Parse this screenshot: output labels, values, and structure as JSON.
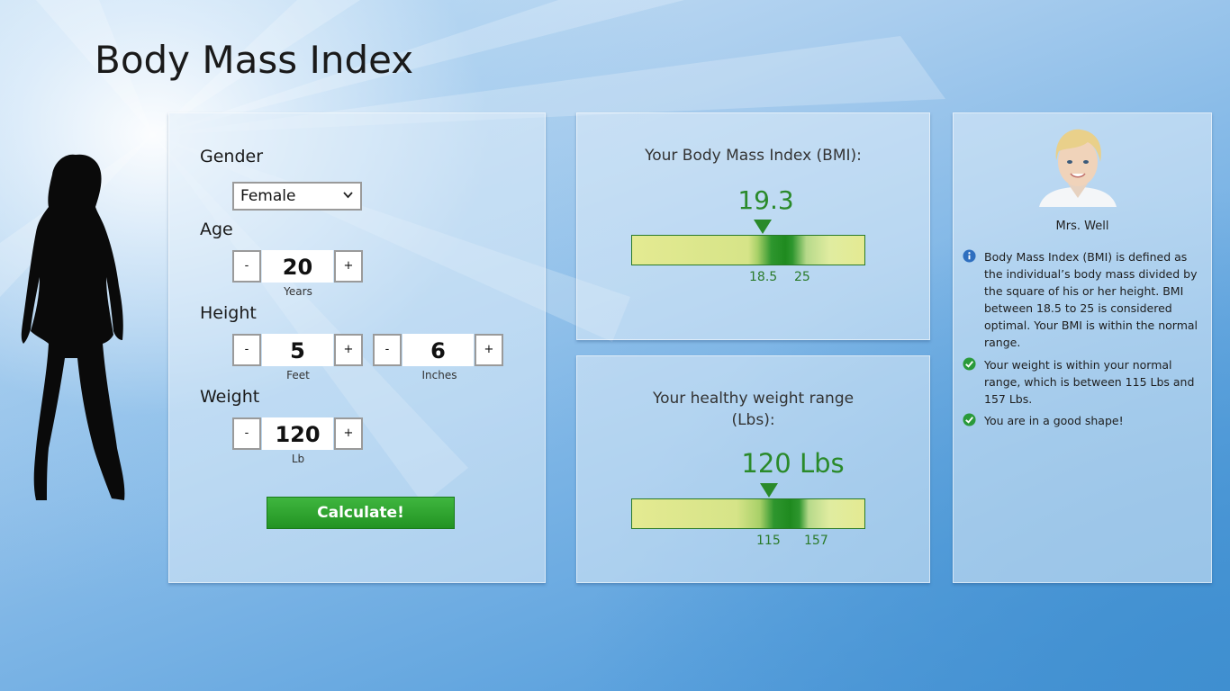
{
  "app": {
    "title": "Body Mass Index"
  },
  "form": {
    "gender_label": "Gender",
    "gender_value": "Female",
    "age_label": "Age",
    "age_value": "20",
    "age_unit": "Years",
    "height_label": "Height",
    "height_feet_value": "5",
    "height_feet_unit": "Feet",
    "height_inches_value": "6",
    "height_inches_unit": "Inches",
    "weight_label": "Weight",
    "weight_value": "120",
    "weight_unit": "Lb",
    "minus": "-",
    "plus": "+",
    "calculate_label": "Calculate!"
  },
  "bmi": {
    "heading": "Your Body Mass Index (BMI):",
    "value": "19.3",
    "range_low": "18.5",
    "range_high": "25"
  },
  "weight_range": {
    "heading_line1": "Your healthy weight range",
    "heading_line2": "(Lbs):",
    "value": "120 Lbs",
    "range_low": "115",
    "range_high": "157"
  },
  "advisor": {
    "name": "Mrs. Well",
    "messages": [
      {
        "icon": "info-icon",
        "text": "Body Mass Index (BMI) is defined as the individual’s body mass divided by the square of his or her height. BMI between 18.5 to 25 is considered optimal. Your BMI is within the normal range."
      },
      {
        "icon": "check-icon",
        "text": "Your weight is within your normal range, which is between 115 Lbs and 157 Lbs."
      },
      {
        "icon": "check-icon",
        "text": "You are in a good shape!"
      }
    ]
  },
  "colors": {
    "accent_green": "#2a8a2a",
    "button_green": "#2ea52e",
    "bar_light": "#e6eb94"
  }
}
